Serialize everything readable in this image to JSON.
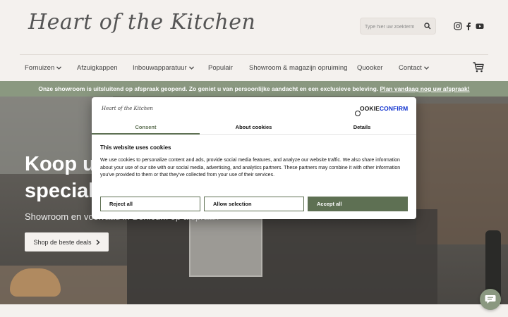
{
  "header": {
    "logo_text": "Heart of the Kitchen",
    "search_placeholder": "Type hier uw zoekterm",
    "social": [
      "instagram-icon",
      "facebook-icon",
      "youtube-icon"
    ]
  },
  "nav": {
    "items": [
      {
        "label": "Fornuizen",
        "dropdown": true
      },
      {
        "label": "Afzuigkappen",
        "dropdown": false
      },
      {
        "label": "Inbouwapparatuur",
        "dropdown": true
      },
      {
        "label": "Populair",
        "dropdown": false
      },
      {
        "label": "Showroom & magazijn opruiming",
        "dropdown": false
      },
      {
        "label": "Quooker",
        "dropdown": false
      },
      {
        "label": "Contact",
        "dropdown": true
      }
    ],
    "cart_icon": "cart-icon"
  },
  "banner": {
    "text": "Onze showroom is uitsluitend op afspraak geopend. Zo geniet u van persoonlijke aandacht en een exclusieve beleving.",
    "link": "Plan vandaag nog uw afspraak!"
  },
  "hero": {
    "title_line1": "Koop uw",
    "title_line2": "speciali",
    "subtitle": "Showroom en voorraad in Berlicum op afspraak",
    "button": "Shop de beste deals"
  },
  "cookie": {
    "brand": "Heart of the Kitchen",
    "provider_logo": {
      "c": "C",
      "rest": "OOKIE",
      "confirm": "CONFIRM"
    },
    "tabs": [
      "Consent",
      "About cookies",
      "Details"
    ],
    "active_tab": "Consent",
    "title": "This website uses cookies",
    "body": "We use cookies to personalize content and ads, provide social media features, and analyze our website traffic. We also share information about your use of our site with our social media, advertising, and analytics partners. These partners may combine it with other information you've provided to them or that they've collected from your use of their services.",
    "buttons": {
      "reject": "Reject all",
      "selection": "Allow selection",
      "accept": "Accept all"
    },
    "accent": "#5e7053"
  },
  "colors": {
    "background": "#f4f1ee",
    "banner": "#8a9880",
    "provider_blue": "#1032cf"
  },
  "chat": {
    "icon": "chat-icon"
  }
}
